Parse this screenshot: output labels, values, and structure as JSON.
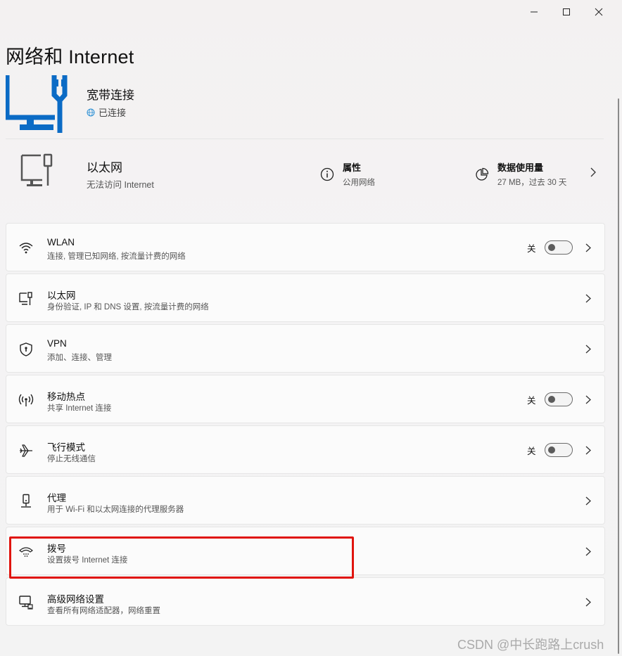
{
  "window": {
    "controls": {
      "minimize": "—",
      "maximize": "☐",
      "close": "✕"
    }
  },
  "page": {
    "title": "网络和 Internet"
  },
  "hero": {
    "title": "宽带连接",
    "status": "已连接",
    "icon": "network-monitor-icon",
    "accent": "#0b6bc5"
  },
  "ethernet": {
    "title": "以太网",
    "subtitle": "无法访问 Internet",
    "properties": {
      "title": "属性",
      "subtitle": "公用网络"
    },
    "usage": {
      "title": "数据使用量",
      "subtitle": "27 MB，过去 30 天"
    }
  },
  "settings": [
    {
      "key": "wlan",
      "icon": "wifi-icon",
      "title": "WLAN",
      "subtitle": "连接, 管理已知网络, 按流量计费的网络",
      "toggle": "关"
    },
    {
      "key": "ethernet",
      "icon": "ethernet-icon",
      "title": "以太网",
      "subtitle": "身份验证, IP 和 DNS 设置, 按流量计费的网络"
    },
    {
      "key": "vpn",
      "icon": "shield-icon",
      "title": "VPN",
      "subtitle": "添加、连接、管理"
    },
    {
      "key": "hotspot",
      "icon": "hotspot-icon",
      "title": "移动热点",
      "subtitle": "共享 Internet 连接",
      "toggle": "关"
    },
    {
      "key": "airplane",
      "icon": "airplane-icon",
      "title": "飞行模式",
      "subtitle": "停止无线通信",
      "toggle": "关"
    },
    {
      "key": "proxy",
      "icon": "proxy-icon",
      "title": "代理",
      "subtitle": "用于 Wi-Fi 和以太网连接的代理服务器"
    },
    {
      "key": "dialup",
      "icon": "dialup-icon",
      "title": "拨号",
      "subtitle": "设置拨号 Internet 连接"
    },
    {
      "key": "advanced",
      "icon": "advanced-network-icon",
      "title": "高级网络设置",
      "subtitle": "查看所有网络适配器，网络重置"
    }
  ],
  "highlight": {
    "target": "dialup",
    "color": "#e0140e"
  },
  "watermark": "CSDN @中长跑路上crush"
}
